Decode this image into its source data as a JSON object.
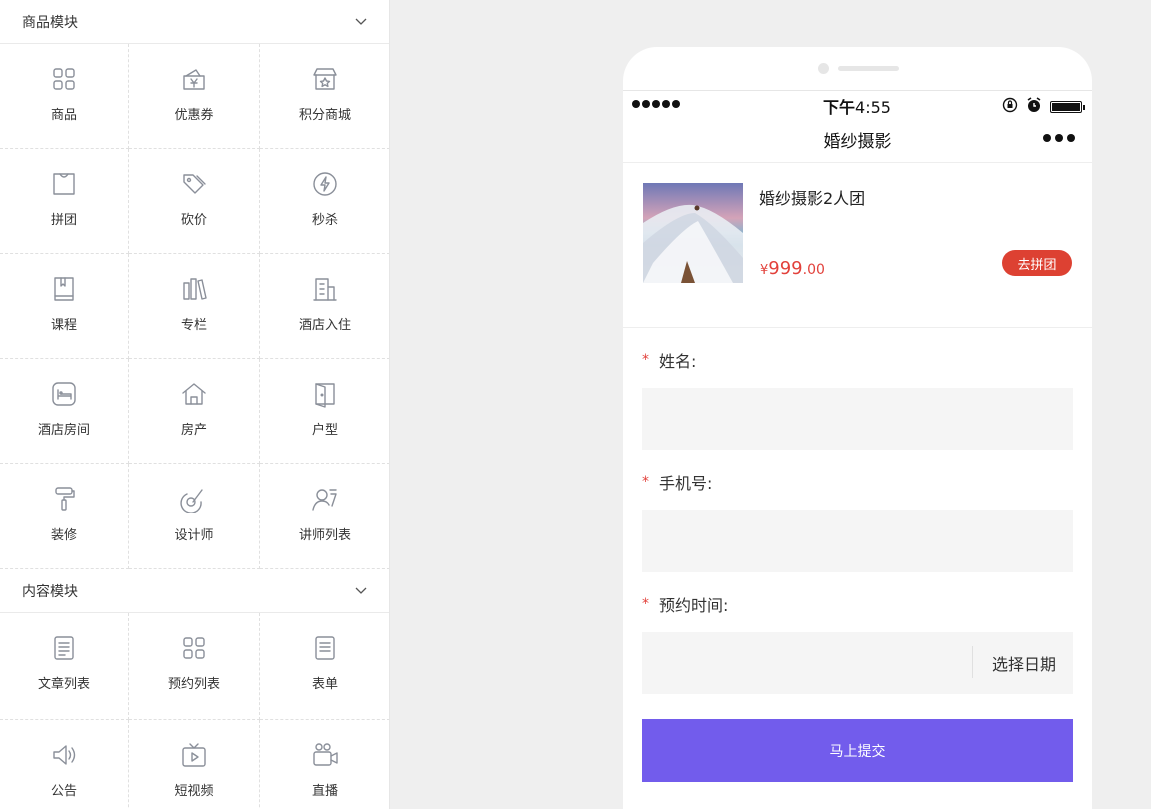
{
  "goods_module": {
    "title": "商品模块",
    "items": [
      {
        "label": "商品",
        "icon": "grid-icon"
      },
      {
        "label": "优惠券",
        "icon": "coupon-icon"
      },
      {
        "label": "积分商城",
        "icon": "store-icon"
      },
      {
        "label": "拼团",
        "icon": "bag-icon"
      },
      {
        "label": "砍价",
        "icon": "price-tag-icon"
      },
      {
        "label": "秒杀",
        "icon": "lightning-icon"
      },
      {
        "label": "课程",
        "icon": "book-icon"
      },
      {
        "label": "专栏",
        "icon": "books-icon"
      },
      {
        "label": "酒店入住",
        "icon": "building-icon"
      },
      {
        "label": "酒店房间",
        "icon": "bed-icon"
      },
      {
        "label": "房产",
        "icon": "house-icon"
      },
      {
        "label": "户型",
        "icon": "door-icon"
      },
      {
        "label": "装修",
        "icon": "paint-roller-icon"
      },
      {
        "label": "设计师",
        "icon": "palette-icon"
      },
      {
        "label": "讲师列表",
        "icon": "teacher-icon"
      }
    ]
  },
  "content_module": {
    "title": "内容模块",
    "items": [
      {
        "label": "文章列表",
        "icon": "article-icon"
      },
      {
        "label": "预约列表",
        "icon": "grid-icon"
      },
      {
        "label": "表单",
        "icon": "form-icon"
      },
      {
        "label": "公告",
        "icon": "speaker-icon"
      },
      {
        "label": "短视频",
        "icon": "tv-icon"
      },
      {
        "label": "直播",
        "icon": "camera-icon"
      }
    ]
  },
  "phone": {
    "status": {
      "time_prefix": "下午",
      "time": "4:55"
    },
    "nav_title": "婚纱摄影",
    "product": {
      "title": "婚纱摄影2人团",
      "price_symbol": "¥",
      "price_int": "999",
      "price_dec": ".00",
      "button": "去拼团"
    },
    "form": {
      "required_mark": "*",
      "name_label": "姓名:",
      "phone_label": "手机号:",
      "time_label": "预约时间:",
      "date_picker": "选择日期",
      "submit": "马上提交"
    }
  },
  "colors": {
    "accent": "#725cec",
    "price": "#e2413b",
    "group_button": "#dd4132"
  }
}
